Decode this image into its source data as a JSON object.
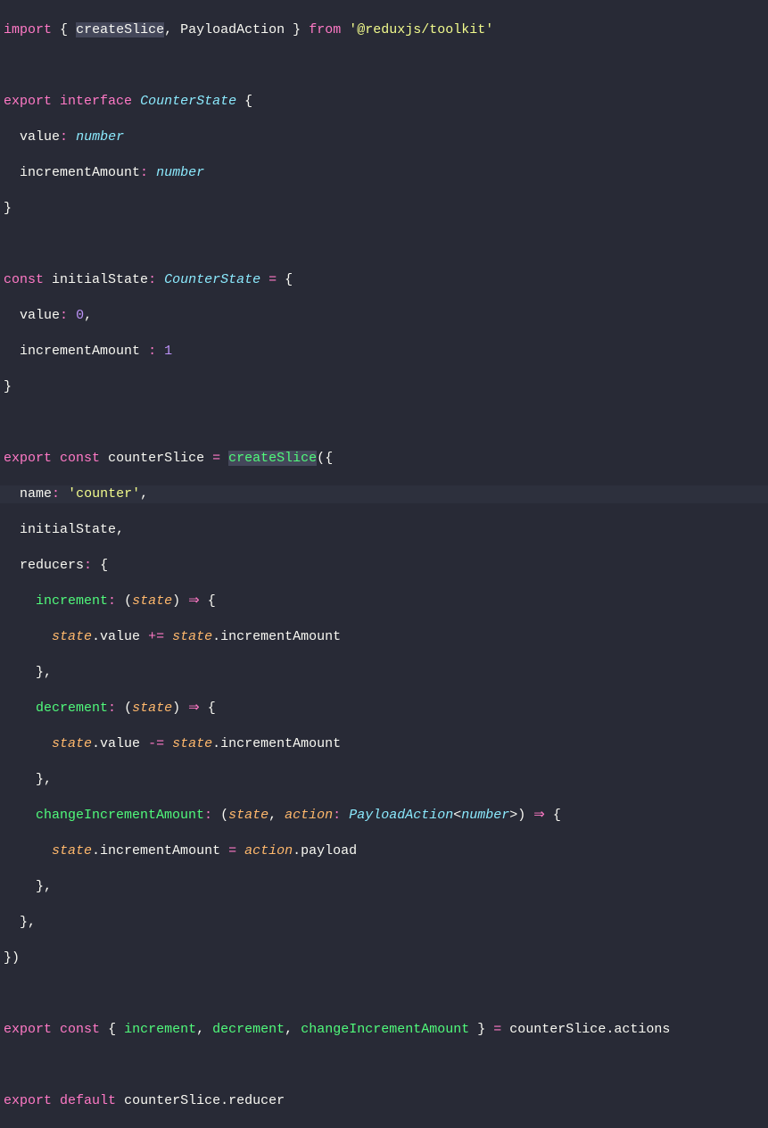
{
  "code": {
    "import_kw": "import",
    "from_kw": "from",
    "export_kw": "export",
    "interface_kw": "interface",
    "const_kw": "const",
    "default_kw": "default",
    "createSlice": "createSlice",
    "PayloadAction": "PayloadAction",
    "toolkit_pkg": "'@reduxjs/toolkit'",
    "CounterState": "CounterState",
    "value_prop": "value",
    "number_type": "number",
    "incrementAmount_prop": "incrementAmount",
    "initialState": "initialState",
    "zero": "0",
    "one": "1",
    "counterSlice": "counterSlice",
    "name_key": "name",
    "counter_str": "'counter'",
    "reducers_key": "reducers",
    "increment": "increment",
    "decrement": "decrement",
    "changeIncrementAmount": "changeIncrementAmount",
    "state_param": "state",
    "action_param": "action",
    "value_field": "value",
    "incrementAmount_field": "incrementAmount",
    "payload_field": "payload",
    "actions_field": "actions",
    "reducer_field": "reducer",
    "plus_eq": "+=",
    "minus_eq": "-=",
    "eq": "=",
    "arrow": "⇒",
    "lbrace": "{",
    "rbrace": "}",
    "lparen": "(",
    "rparen": ")",
    "langle": "<",
    "rangle": ">",
    "comma": ",",
    "colon": ":",
    "dot": "."
  }
}
